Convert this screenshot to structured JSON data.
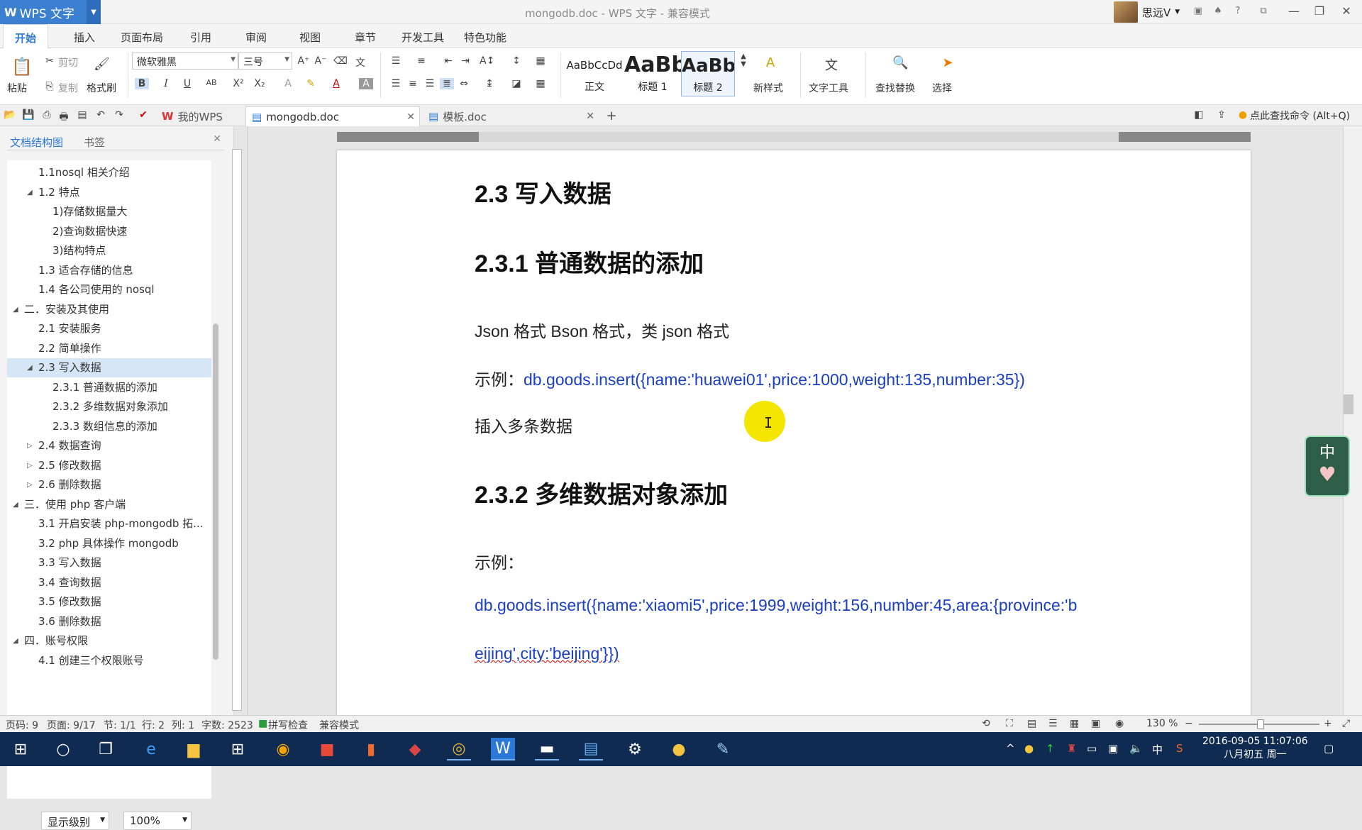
{
  "titlebar": {
    "app_name": "WPS 文字",
    "app_logo": "W",
    "document_title": "mongodb.doc - WPS 文字 - 兼容模式",
    "user_name": "思远V",
    "window_buttons": [
      "—",
      "❐",
      "✕"
    ]
  },
  "menu": {
    "tabs": [
      "开始",
      "插入",
      "页面布局",
      "引用",
      "审阅",
      "视图",
      "章节",
      "开发工具",
      "特色功能"
    ]
  },
  "ribbon": {
    "paste": "粘贴",
    "cut": "剪切",
    "copy": "复制",
    "format_painter": "格式刷",
    "font_name": "微软雅黑",
    "font_size": "三号",
    "styles": [
      {
        "preview": "AaBbCcDd",
        "label": "正文"
      },
      {
        "preview": "AaBb",
        "label": "标题 1"
      },
      {
        "preview": "AaBb(",
        "label": "标题 2"
      }
    ],
    "new_style": "新样式",
    "text_tools": "文字工具",
    "find_replace": "查找替换",
    "select": "选择"
  },
  "doc_tabs": [
    {
      "label": "我的WPS"
    },
    {
      "label": "mongodb.doc"
    },
    {
      "label": "模板.doc"
    }
  ],
  "command_search": "点此查找命令 (Alt+Q)",
  "left_pane": {
    "tabs": [
      "文档结构图",
      "书签"
    ],
    "outline": [
      {
        "label": "1.1nosql 相关介绍",
        "level": 2,
        "toggle": ""
      },
      {
        "label": "1.2 特点",
        "level": 2,
        "toggle": "◢"
      },
      {
        "label": "1)存储数据量大",
        "level": 3,
        "toggle": ""
      },
      {
        "label": "2)查询数据快速",
        "level": 3,
        "toggle": ""
      },
      {
        "label": "3)结构特点",
        "level": 3,
        "toggle": ""
      },
      {
        "label": "1.3 适合存储的信息",
        "level": 2,
        "toggle": ""
      },
      {
        "label": "1.4 各公司使用的 nosql",
        "level": 2,
        "toggle": ""
      },
      {
        "label": "二．安装及其使用",
        "level": 1,
        "toggle": "◢"
      },
      {
        "label": "2.1 安装服务",
        "level": 2,
        "toggle": ""
      },
      {
        "label": "2.2 简单操作",
        "level": 2,
        "toggle": ""
      },
      {
        "label": "2.3 写入数据",
        "level": 2,
        "toggle": "◢",
        "selected": true
      },
      {
        "label": "2.3.1 普通数据的添加",
        "level": 3,
        "toggle": ""
      },
      {
        "label": "2.3.2 多维数据对象添加",
        "level": 3,
        "toggle": ""
      },
      {
        "label": "2.3.3 数组信息的添加",
        "level": 3,
        "toggle": ""
      },
      {
        "label": "2.4 数据查询",
        "level": 2,
        "toggle": "▷"
      },
      {
        "label": "2.5 修改数据",
        "level": 2,
        "toggle": "▷"
      },
      {
        "label": "2.6 删除数据",
        "level": 2,
        "toggle": "▷"
      },
      {
        "label": "三．使用 php 客户端",
        "level": 1,
        "toggle": "◢"
      },
      {
        "label": "3.1 开启安装 php-mongodb 拓...",
        "level": 2,
        "toggle": ""
      },
      {
        "label": "3.2 php 具体操作 mongodb",
        "level": 2,
        "toggle": ""
      },
      {
        "label": "3.3 写入数据",
        "level": 2,
        "toggle": ""
      },
      {
        "label": "3.4 查询数据",
        "level": 2,
        "toggle": ""
      },
      {
        "label": "3.5 修改数据",
        "level": 2,
        "toggle": ""
      },
      {
        "label": "3.6 删除数据",
        "level": 2,
        "toggle": ""
      },
      {
        "label": "四．账号权限",
        "level": 1,
        "toggle": "◢"
      },
      {
        "label": "4.1 创建三个权限账号",
        "level": 2,
        "toggle": ""
      }
    ],
    "level_select": "显示级别",
    "zoom_select": "100%"
  },
  "document": {
    "h_23": "2.3 写入数据",
    "h_231": "2.3.1 普通数据的添加",
    "p_formats": "Json 格式  Bson 格式，类 json 格式",
    "p_example1_label": "示例：",
    "p_example1_code": "db.goods.insert({name:'huawei01',price:1000,weight:135,number:35})",
    "p_insert_multi": "插入多条数据",
    "h_232": "2.3.2 多维数据对象添加",
    "p_example2_label": "示例：",
    "p_example2_code_line1": "db.goods.insert({name:'xiaomi5',price:1999,weight:156,number:45,area:{province:'b",
    "p_example2_code_line2": "eijing',city:'beijing'}})"
  },
  "statusbar": {
    "page_code": "页码: 9",
    "page": "页面: 9/17",
    "section": "节: 1/1",
    "row": "行: 2",
    "col": "列: 1",
    "chars": "字数: 2523",
    "spell": "拼写检查",
    "compat": "兼容模式",
    "zoom": "130 %"
  },
  "taskbar": {
    "clock_time": "2016-09-05  11:07:06",
    "clock_date": "八月初五 周一",
    "ime": "中"
  },
  "ime_widget": "中"
}
